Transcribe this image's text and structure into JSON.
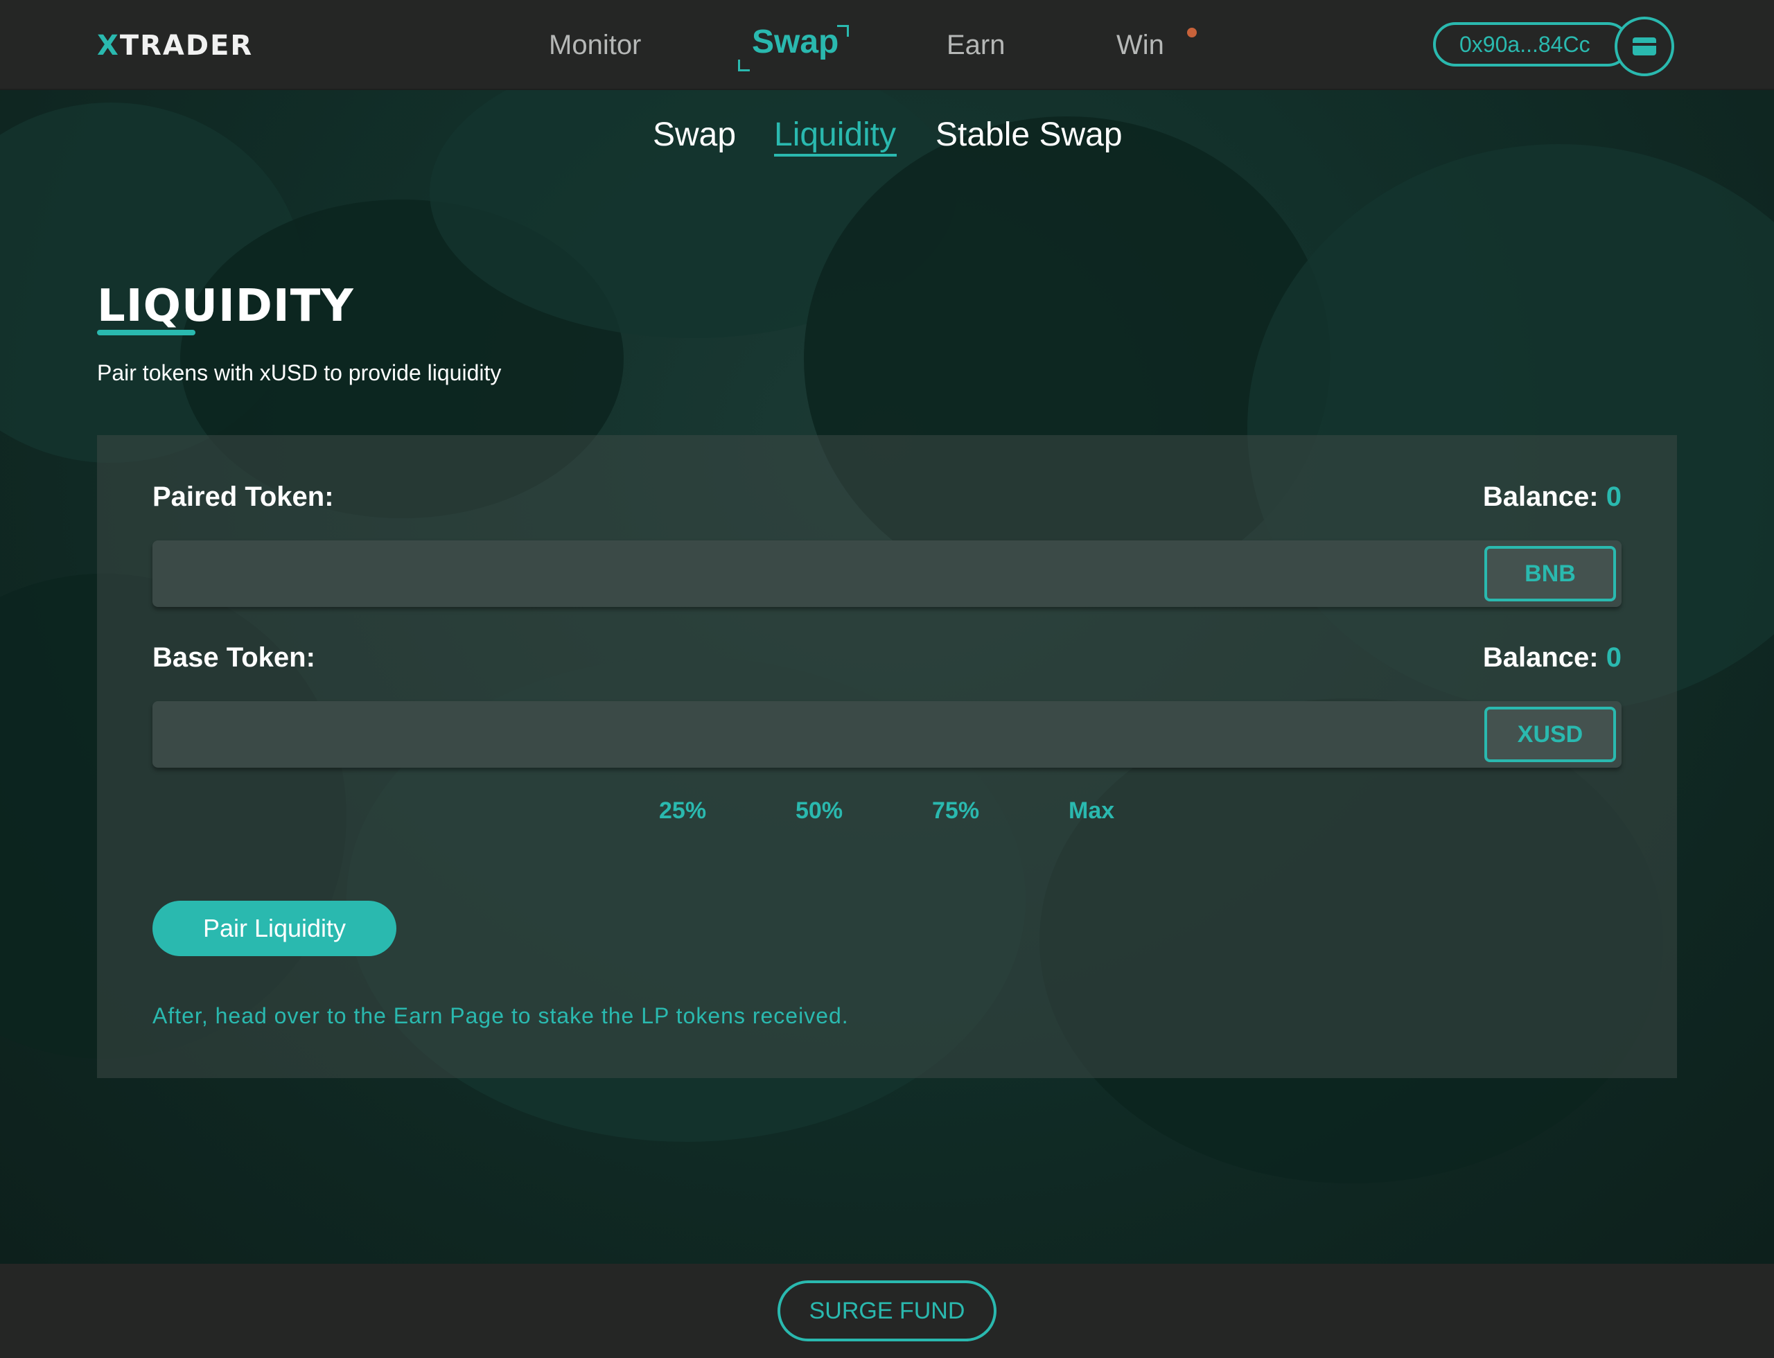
{
  "brand": {
    "logo_x": "X",
    "logo_rest": "TRADER"
  },
  "nav": {
    "items": [
      {
        "label": "Monitor"
      },
      {
        "label": "Swap"
      },
      {
        "label": "Earn"
      },
      {
        "label": "Win"
      }
    ],
    "active": "Swap"
  },
  "wallet": {
    "address": "0x90a...84Cc",
    "icon": "wallet-icon"
  },
  "subnav": {
    "items": [
      {
        "label": "Swap"
      },
      {
        "label": "Liquidity"
      },
      {
        "label": "Stable Swap"
      }
    ],
    "active": "Liquidity"
  },
  "page": {
    "title": "LIQUIDITY",
    "subtitle": "Pair tokens with xUSD to provide liquidity"
  },
  "form": {
    "paired": {
      "label": "Paired Token:",
      "balance_label": "Balance:",
      "balance_value": "0",
      "value": "",
      "token": "BNB"
    },
    "base": {
      "label": "Base Token:",
      "balance_label": "Balance:",
      "balance_value": "0",
      "value": "",
      "token": "XUSD"
    },
    "percentages": [
      "25%",
      "50%",
      "75%",
      "Max"
    ],
    "submit_label": "Pair Liquidity",
    "note": "After, head over to the Earn Page to stake the LP tokens received."
  },
  "footer": {
    "button_label": "SURGE FUND"
  },
  "colors": {
    "accent": "#2ab9af",
    "header_bg": "#252625",
    "page_bg": "#0f2420",
    "notification_dot": "#c8623a"
  }
}
